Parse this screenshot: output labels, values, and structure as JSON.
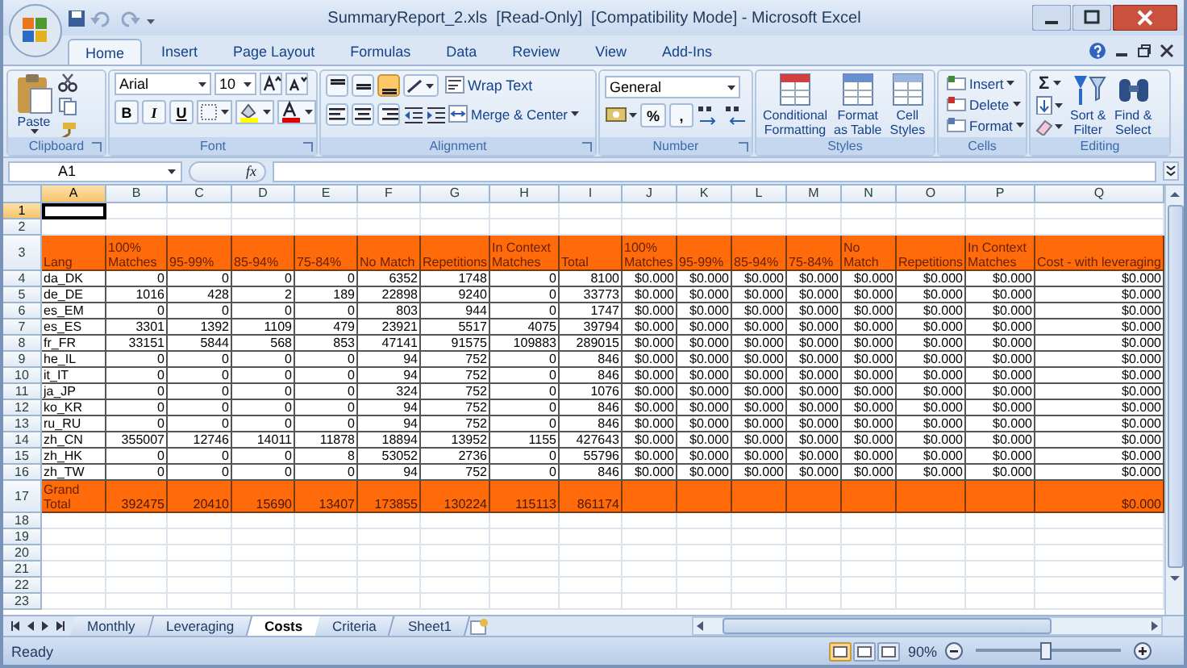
{
  "window": {
    "title": "SummaryReport_2.xls  [Read-Only]  [Compatibility Mode] - Microsoft Excel"
  },
  "ribbon": {
    "tabs": [
      {
        "label": "Home",
        "selected": true
      },
      {
        "label": "Insert",
        "selected": false
      },
      {
        "label": "Page Layout",
        "selected": false
      },
      {
        "label": "Formulas",
        "selected": false
      },
      {
        "label": "Data",
        "selected": false
      },
      {
        "label": "Review",
        "selected": false
      },
      {
        "label": "View",
        "selected": false
      },
      {
        "label": "Add-Ins",
        "selected": false
      }
    ],
    "groups": [
      {
        "kind": "clipboard",
        "label": "Clipboard",
        "buttons": [
          "Paste"
        ]
      },
      {
        "kind": "font",
        "label": "Font",
        "font": "Arial",
        "size": "10",
        "buttons": [
          "B",
          "I",
          "U"
        ]
      },
      {
        "kind": "alignment",
        "label": "Alignment",
        "buttons": [
          "Wrap Text",
          "Merge & Center"
        ],
        "vertical": [
          {
            "selected": false
          },
          {
            "selected": false
          },
          {
            "selected": true
          }
        ]
      },
      {
        "kind": "number",
        "label": "Number",
        "format": "General",
        "buttons": [
          "%",
          ","
        ]
      },
      {
        "kind": "styles",
        "label": "Styles",
        "buttons": [
          "Conditional\nFormatting",
          "Format\nas Table",
          "Cell\nStyles"
        ]
      },
      {
        "kind": "cells",
        "label": "Cells",
        "buttons": [
          "Insert",
          "Delete",
          "Format"
        ]
      },
      {
        "kind": "editing",
        "label": "Editing",
        "buttons": [
          "Σ",
          "Sort &\nFilter",
          "Find &\nSelect"
        ]
      }
    ]
  },
  "formula_bar": {
    "name_box": "A1",
    "function_button": "fx"
  },
  "sheet": {
    "columns": [
      {
        "letter": "A",
        "selected": true
      },
      {
        "letter": "B",
        "selected": false
      },
      {
        "letter": "C",
        "selected": false
      },
      {
        "letter": "D",
        "selected": false
      },
      {
        "letter": "E",
        "selected": false
      },
      {
        "letter": "F",
        "selected": false
      },
      {
        "letter": "G",
        "selected": false
      },
      {
        "letter": "H",
        "selected": false
      },
      {
        "letter": "I",
        "selected": false
      },
      {
        "letter": "J",
        "selected": false
      },
      {
        "letter": "K",
        "selected": false
      },
      {
        "letter": "L",
        "selected": false
      },
      {
        "letter": "M",
        "selected": false
      },
      {
        "letter": "N",
        "selected": false
      },
      {
        "letter": "O",
        "selected": false
      },
      {
        "letter": "P",
        "selected": false
      },
      {
        "letter": "Q",
        "selected": false
      }
    ],
    "rows": [
      {
        "number": "1",
        "selected": true,
        "kind": "blank"
      },
      {
        "number": "2",
        "selected": false,
        "kind": "blank"
      },
      {
        "number": "3",
        "selected": false,
        "kind": "header",
        "cells": [
          "Lang",
          "100%\nMatches",
          "95-99%",
          "85-94%",
          "75-84%",
          "No Match",
          "Repetitions",
          "In Context\nMatches",
          "Total",
          "100%\nMatches",
          "95-99%",
          "85-94%",
          "75-84%",
          "No Match",
          "Repetitions",
          "In Context\nMatches",
          "Cost - with leveraging"
        ]
      },
      {
        "number": "4",
        "selected": false,
        "kind": "data",
        "cells": [
          "da_DK",
          "0",
          "0",
          "0",
          "0",
          "6352",
          "1748",
          "0",
          "8100",
          "$0.000",
          "$0.000",
          "$0.000",
          "$0.000",
          "$0.000",
          "$0.000",
          "$0.000",
          "$0.000"
        ]
      },
      {
        "number": "5",
        "selected": false,
        "kind": "data",
        "cells": [
          "de_DE",
          "1016",
          "428",
          "2",
          "189",
          "22898",
          "9240",
          "0",
          "33773",
          "$0.000",
          "$0.000",
          "$0.000",
          "$0.000",
          "$0.000",
          "$0.000",
          "$0.000",
          "$0.000"
        ]
      },
      {
        "number": "6",
        "selected": false,
        "kind": "data",
        "cells": [
          "es_EM",
          "0",
          "0",
          "0",
          "0",
          "803",
          "944",
          "0",
          "1747",
          "$0.000",
          "$0.000",
          "$0.000",
          "$0.000",
          "$0.000",
          "$0.000",
          "$0.000",
          "$0.000"
        ]
      },
      {
        "number": "7",
        "selected": false,
        "kind": "data",
        "cells": [
          "es_ES",
          "3301",
          "1392",
          "1109",
          "479",
          "23921",
          "5517",
          "4075",
          "39794",
          "$0.000",
          "$0.000",
          "$0.000",
          "$0.000",
          "$0.000",
          "$0.000",
          "$0.000",
          "$0.000"
        ]
      },
      {
        "number": "8",
        "selected": false,
        "kind": "data",
        "cells": [
          "fr_FR",
          "33151",
          "5844",
          "568",
          "853",
          "47141",
          "91575",
          "109883",
          "289015",
          "$0.000",
          "$0.000",
          "$0.000",
          "$0.000",
          "$0.000",
          "$0.000",
          "$0.000",
          "$0.000"
        ]
      },
      {
        "number": "9",
        "selected": false,
        "kind": "data",
        "cells": [
          "he_IL",
          "0",
          "0",
          "0",
          "0",
          "94",
          "752",
          "0",
          "846",
          "$0.000",
          "$0.000",
          "$0.000",
          "$0.000",
          "$0.000",
          "$0.000",
          "$0.000",
          "$0.000"
        ]
      },
      {
        "number": "10",
        "selected": false,
        "kind": "data",
        "cells": [
          "it_IT",
          "0",
          "0",
          "0",
          "0",
          "94",
          "752",
          "0",
          "846",
          "$0.000",
          "$0.000",
          "$0.000",
          "$0.000",
          "$0.000",
          "$0.000",
          "$0.000",
          "$0.000"
        ]
      },
      {
        "number": "11",
        "selected": false,
        "kind": "data",
        "cells": [
          "ja_JP",
          "0",
          "0",
          "0",
          "0",
          "324",
          "752",
          "0",
          "1076",
          "$0.000",
          "$0.000",
          "$0.000",
          "$0.000",
          "$0.000",
          "$0.000",
          "$0.000",
          "$0.000"
        ]
      },
      {
        "number": "12",
        "selected": false,
        "kind": "data",
        "cells": [
          "ko_KR",
          "0",
          "0",
          "0",
          "0",
          "94",
          "752",
          "0",
          "846",
          "$0.000",
          "$0.000",
          "$0.000",
          "$0.000",
          "$0.000",
          "$0.000",
          "$0.000",
          "$0.000"
        ]
      },
      {
        "number": "13",
        "selected": false,
        "kind": "data",
        "cells": [
          "ru_RU",
          "0",
          "0",
          "0",
          "0",
          "94",
          "752",
          "0",
          "846",
          "$0.000",
          "$0.000",
          "$0.000",
          "$0.000",
          "$0.000",
          "$0.000",
          "$0.000",
          "$0.000"
        ]
      },
      {
        "number": "14",
        "selected": false,
        "kind": "data",
        "cells": [
          "zh_CN",
          "355007",
          "12746",
          "14011",
          "11878",
          "18894",
          "13952",
          "1155",
          "427643",
          "$0.000",
          "$0.000",
          "$0.000",
          "$0.000",
          "$0.000",
          "$0.000",
          "$0.000",
          "$0.000"
        ]
      },
      {
        "number": "15",
        "selected": false,
        "kind": "data",
        "cells": [
          "zh_HK",
          "0",
          "0",
          "0",
          "8",
          "53052",
          "2736",
          "0",
          "55796",
          "$0.000",
          "$0.000",
          "$0.000",
          "$0.000",
          "$0.000",
          "$0.000",
          "$0.000",
          "$0.000"
        ]
      },
      {
        "number": "16",
        "selected": false,
        "kind": "data",
        "cells": [
          "zh_TW",
          "0",
          "0",
          "0",
          "0",
          "94",
          "752",
          "0",
          "846",
          "$0.000",
          "$0.000",
          "$0.000",
          "$0.000",
          "$0.000",
          "$0.000",
          "$0.000",
          "$0.000"
        ]
      },
      {
        "number": "17",
        "selected": false,
        "kind": "total",
        "cells": [
          "Grand\nTotal",
          "392475",
          "20410",
          "15690",
          "13407",
          "173855",
          "130224",
          "115113",
          "861174"
        ],
        "cost_total": "$0.000"
      },
      {
        "number": "18",
        "selected": false,
        "kind": "blank"
      },
      {
        "number": "19",
        "selected": false,
        "kind": "blank"
      },
      {
        "number": "20",
        "selected": false,
        "kind": "blank"
      },
      {
        "number": "21",
        "selected": false,
        "kind": "blank"
      },
      {
        "number": "22",
        "selected": false,
        "kind": "blank"
      },
      {
        "number": "23",
        "selected": false,
        "kind": "blank"
      }
    ]
  },
  "sheet_tabs": [
    {
      "label": "Monthly",
      "selected": false
    },
    {
      "label": "Leveraging",
      "selected": false
    },
    {
      "label": "Costs",
      "selected": true
    },
    {
      "label": "Criteria",
      "selected": false
    },
    {
      "label": "Sheet1",
      "selected": false
    }
  ],
  "status_bar": {
    "text": "Ready",
    "views": [
      {
        "selected": true
      },
      {
        "selected": false
      },
      {
        "selected": false
      }
    ],
    "zoom": "90%",
    "zoom_slider": {
      "level": 0.48
    }
  }
}
